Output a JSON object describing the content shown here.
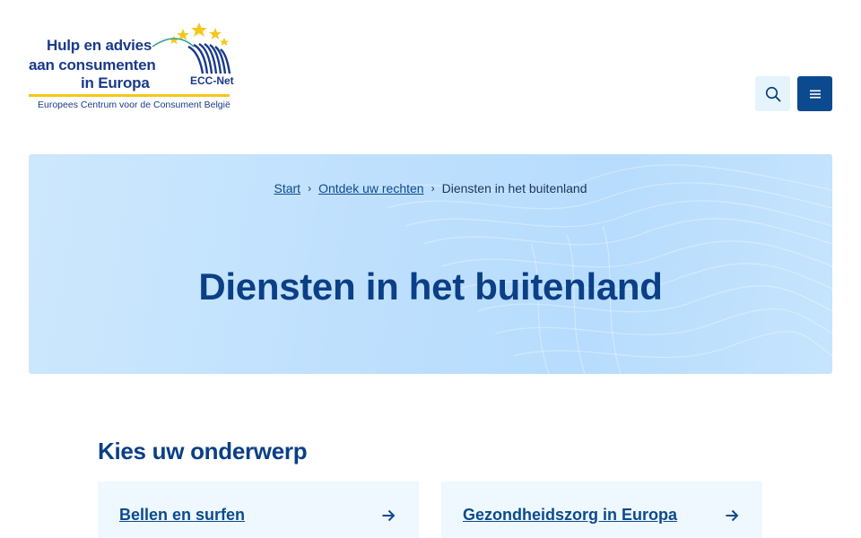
{
  "header": {
    "logo": {
      "line1": "Hulp en advies",
      "line2": "aan consumenten",
      "line3": "in Europa",
      "network": "ECC-Net",
      "subtitle": "Europees Centrum voor de Consument België"
    },
    "search_icon": "search-icon",
    "menu_icon": "hamburger-menu-icon"
  },
  "hero": {
    "breadcrumb": {
      "items": [
        "Start",
        "Ontdek uw rechten"
      ],
      "current": "Diensten in het buitenland"
    },
    "title": "Diensten in het buitenland"
  },
  "topics": {
    "heading": "Kies uw onderwerp",
    "cards": [
      {
        "label": "Bellen en surfen",
        "icon": "arrow-right-icon"
      },
      {
        "label": "Gezondheidszorg in Europa",
        "icon": "arrow-right-icon"
      }
    ]
  },
  "colors": {
    "primary": "#0b4a8f",
    "title": "#0b3f86",
    "hero_bg": "#bfe0fd",
    "card_bg": "#eef8fe",
    "search_bg": "#e4f3fc",
    "logo_accent": "#f5c71a"
  }
}
